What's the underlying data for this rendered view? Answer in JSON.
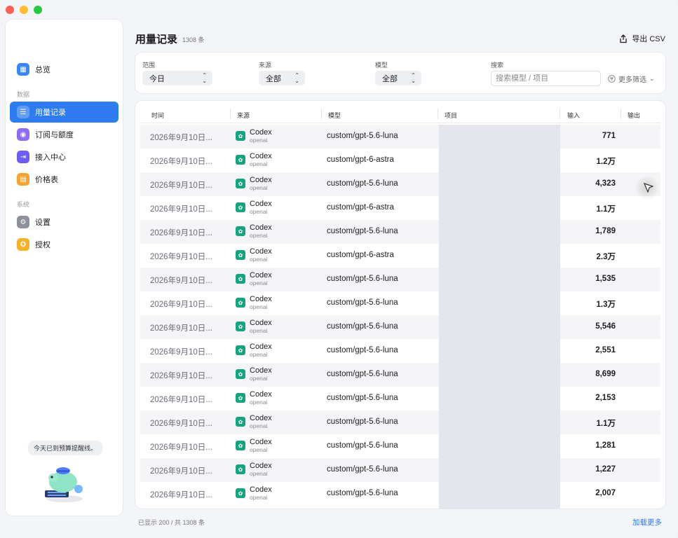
{
  "sidebar": {
    "overview": "总览",
    "section_data": "数据",
    "usage": "用量记录",
    "subscription": "订阅与额度",
    "access": "接入中心",
    "pricing": "价格表",
    "section_system": "系统",
    "settings": "设置",
    "license": "授权",
    "bubble": "今天已到预算提醒线。"
  },
  "header": {
    "title": "用量记录",
    "count": "1308 条",
    "export": "导出 CSV"
  },
  "filters": {
    "range_label": "范围",
    "range_value": "今日",
    "source_label": "来源",
    "source_value": "全部",
    "model_label": "模型",
    "model_value": "全部",
    "search_label": "搜索",
    "search_placeholder": "搜索模型 / 项目",
    "more": "更多筛选"
  },
  "table": {
    "columns": [
      "时间",
      "来源",
      "模型",
      "项目",
      "输入",
      "输出"
    ],
    "rows": [
      {
        "time": "2026年9月10日...",
        "source": "Codex",
        "provider": "openai",
        "model": "custom/gpt-5.6-luna",
        "input": "771"
      },
      {
        "time": "2026年9月10日...",
        "source": "Codex",
        "provider": "openai",
        "model": "custom/gpt-6-astra",
        "input": "1.2万"
      },
      {
        "time": "2026年9月10日...",
        "source": "Codex",
        "provider": "openai",
        "model": "custom/gpt-5.6-luna",
        "input": "4,323"
      },
      {
        "time": "2026年9月10日...",
        "source": "Codex",
        "provider": "openai",
        "model": "custom/gpt-6-astra",
        "input": "1.1万"
      },
      {
        "time": "2026年9月10日...",
        "source": "Codex",
        "provider": "openai",
        "model": "custom/gpt-5.6-luna",
        "input": "1,789"
      },
      {
        "time": "2026年9月10日...",
        "source": "Codex",
        "provider": "openai",
        "model": "custom/gpt-6-astra",
        "input": "2.3万"
      },
      {
        "time": "2026年9月10日...",
        "source": "Codex",
        "provider": "openai",
        "model": "custom/gpt-5.6-luna",
        "input": "1,535"
      },
      {
        "time": "2026年9月10日...",
        "source": "Codex",
        "provider": "openai",
        "model": "custom/gpt-5.6-luna",
        "input": "1.3万"
      },
      {
        "time": "2026年9月10日...",
        "source": "Codex",
        "provider": "openai",
        "model": "custom/gpt-5.6-luna",
        "input": "5,546"
      },
      {
        "time": "2026年9月10日...",
        "source": "Codex",
        "provider": "openai",
        "model": "custom/gpt-5.6-luna",
        "input": "2,551"
      },
      {
        "time": "2026年9月10日...",
        "source": "Codex",
        "provider": "openai",
        "model": "custom/gpt-5.6-luna",
        "input": "8,699"
      },
      {
        "time": "2026年9月10日...",
        "source": "Codex",
        "provider": "openai",
        "model": "custom/gpt-5.6-luna",
        "input": "2,153"
      },
      {
        "time": "2026年9月10日...",
        "source": "Codex",
        "provider": "openai",
        "model": "custom/gpt-5.6-luna",
        "input": "1.1万"
      },
      {
        "time": "2026年9月10日...",
        "source": "Codex",
        "provider": "openai",
        "model": "custom/gpt-5.6-luna",
        "input": "1,281"
      },
      {
        "time": "2026年9月10日...",
        "source": "Codex",
        "provider": "openai",
        "model": "custom/gpt-5.6-luna",
        "input": "1,227"
      },
      {
        "time": "2026年9月10日...",
        "source": "Codex",
        "provider": "openai",
        "model": "custom/gpt-5.6-luna",
        "input": "2,007"
      }
    ]
  },
  "footer": {
    "shown": "已显示 200 / 共 1308 条",
    "load_more": "加载更多"
  },
  "colors": {
    "accent": "#2f7bf0",
    "source_icon": "#16a37f"
  }
}
